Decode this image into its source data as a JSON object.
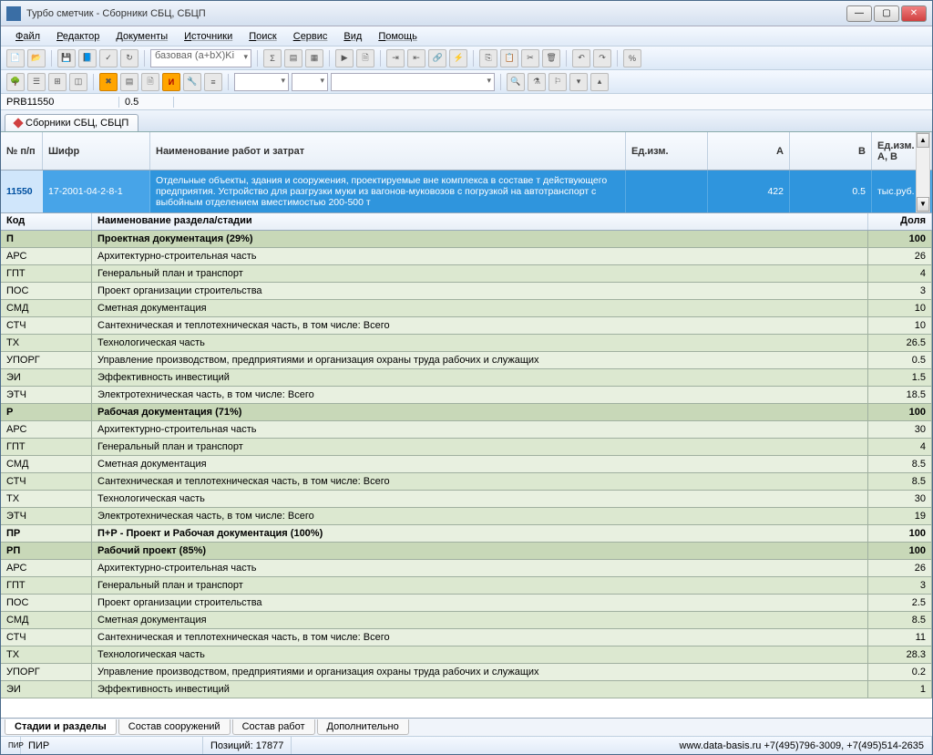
{
  "title": "Турбо сметчик - Сборники СБЦ, СБЦП",
  "menu": [
    "Файл",
    "Редактор",
    "Документы",
    "Источники",
    "Поиск",
    "Сервис",
    "Вид",
    "Помощь"
  ],
  "combo1": "базовая (a+bX)Ki",
  "subbar": {
    "left": "PRB11550",
    "val": "0.5"
  },
  "docTab": "Сборники СБЦ, СБЦП",
  "gridHeaders": {
    "num": "№ п/п",
    "cifr": "Шифр",
    "name": "Наименование работ и затрат",
    "unit": "Ед.изм.",
    "a": "А",
    "b": "В",
    "unit2": "Ед.изм. А, В"
  },
  "row": {
    "num": "11550",
    "cifr": "17-2001-04-2-8-1",
    "name": "Отдельные объекты, здания и сооружения, проектируемые вне комплекса в составе т действующего предприятия. Устройство для разгрузки муки из вагонов-муковозов с погрузкой на автотранспорт с выбойным отделением вместимостью 200-500 т",
    "unit": "",
    "a": "422",
    "b": "0.5",
    "unit2": "тыс.руб."
  },
  "detailHeaders": {
    "code": "Код",
    "name": "Наименование раздела/стадии",
    "val": "Доля"
  },
  "details": [
    {
      "code": "П",
      "name": "Проектная документация (29%)",
      "val": "100",
      "bold": true
    },
    {
      "code": "АРС",
      "name": "Архитектурно-строительная часть",
      "val": "26"
    },
    {
      "code": "ГПТ",
      "name": "Генеральный план и транспорт",
      "val": "4"
    },
    {
      "code": "ПОС",
      "name": "Проект организации строительства",
      "val": "3"
    },
    {
      "code": "СМД",
      "name": "Сметная документация",
      "val": "10"
    },
    {
      "code": "СТЧ",
      "name": "Сантехническая и теплотехническая часть, в том числе: Всего",
      "val": "10"
    },
    {
      "code": "ТХ",
      "name": "Технологическая часть",
      "val": "26.5"
    },
    {
      "code": "УПОРГ",
      "name": "Управление производством, предприятиями и организация охраны труда рабочих и служащих",
      "val": "0.5"
    },
    {
      "code": "ЭИ",
      "name": "Эффективность инвестиций",
      "val": "1.5"
    },
    {
      "code": "ЭТЧ",
      "name": "Электротехническая часть, в том числе: Всего",
      "val": "18.5"
    },
    {
      "code": "Р",
      "name": "Рабочая документация (71%)",
      "val": "100",
      "bold": true
    },
    {
      "code": "АРС",
      "name": "Архитектурно-строительная часть",
      "val": "30"
    },
    {
      "code": "ГПТ",
      "name": "Генеральный план и транспорт",
      "val": "4"
    },
    {
      "code": "СМД",
      "name": "Сметная документация",
      "val": "8.5"
    },
    {
      "code": "СТЧ",
      "name": "Сантехническая и теплотехническая часть, в том числе: Всего",
      "val": "8.5"
    },
    {
      "code": "ТХ",
      "name": "Технологическая часть",
      "val": "30"
    },
    {
      "code": "ЭТЧ",
      "name": "Электротехническая часть, в том числе: Всего",
      "val": "19"
    },
    {
      "code": "ПР",
      "name": "П+Р - Проект и Рабочая документация (100%)",
      "val": "100",
      "bold": true
    },
    {
      "code": "РП",
      "name": "Рабочий проект (85%)",
      "val": "100",
      "bold": true
    },
    {
      "code": "АРС",
      "name": "Архитектурно-строительная часть",
      "val": "26"
    },
    {
      "code": "ГПТ",
      "name": "Генеральный план и транспорт",
      "val": "3"
    },
    {
      "code": "ПОС",
      "name": "Проект организации строительства",
      "val": "2.5"
    },
    {
      "code": "СМД",
      "name": "Сметная документация",
      "val": "8.5"
    },
    {
      "code": "СТЧ",
      "name": "Сантехническая и теплотехническая часть, в том числе: Всего",
      "val": "11"
    },
    {
      "code": "ТХ",
      "name": "Технологическая часть",
      "val": "28.3"
    },
    {
      "code": "УПОРГ",
      "name": "Управление производством, предприятиями и организация охраны труда рабочих и служащих",
      "val": "0.2"
    },
    {
      "code": "ЭИ",
      "name": "Эффективность инвестиций",
      "val": "1"
    }
  ],
  "bottomTabs": [
    "Стадии и разделы",
    "Состав сооружений",
    "Состав работ",
    "Дополнительно"
  ],
  "status": {
    "left1": "ПИР",
    "left2": "",
    "positions": "Позиций: 17877",
    "right": "www.data-basis.ru   +7(495)796-3009, +7(495)514-2635"
  }
}
